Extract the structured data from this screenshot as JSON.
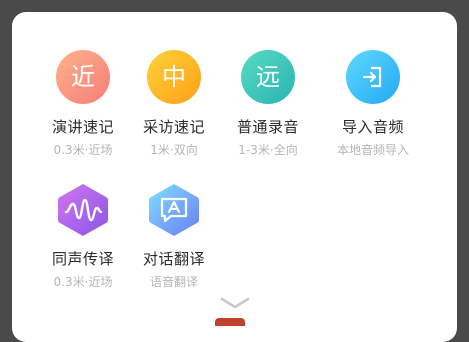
{
  "modes": [
    {
      "glyph": "近",
      "label": "演讲速记",
      "sub": "0.3米·近场",
      "icon": "near-icon",
      "color_from": "#fdb28a",
      "color_to": "#f77d7b"
    },
    {
      "glyph": "中",
      "label": "采访速记",
      "sub": "1米·双向",
      "icon": "middle-icon",
      "color_from": "#ffd23a",
      "color_to": "#fca017"
    },
    {
      "glyph": "远",
      "label": "普通录音",
      "sub": "1-3米·全向",
      "icon": "far-icon",
      "color_from": "#57dbc4",
      "color_to": "#2ab3b1"
    },
    {
      "glyph": "",
      "label": "导入音频",
      "sub": "本地音频导入",
      "icon": "import-icon",
      "color_from": "#5fd9ff",
      "color_to": "#22a9f3"
    },
    {
      "glyph": "",
      "label": "同声传译",
      "sub": "0.3米·近场",
      "icon": "waveform-icon",
      "color_from": "#d176f0",
      "color_to": "#8a56e6"
    },
    {
      "glyph": "",
      "label": "对话翻译",
      "sub": "语音翻译",
      "icon": "chat-translate-icon",
      "color_from": "#7ee0ff",
      "color_to": "#6b7cf5"
    }
  ],
  "collapse_icon": "chevron-down-icon"
}
